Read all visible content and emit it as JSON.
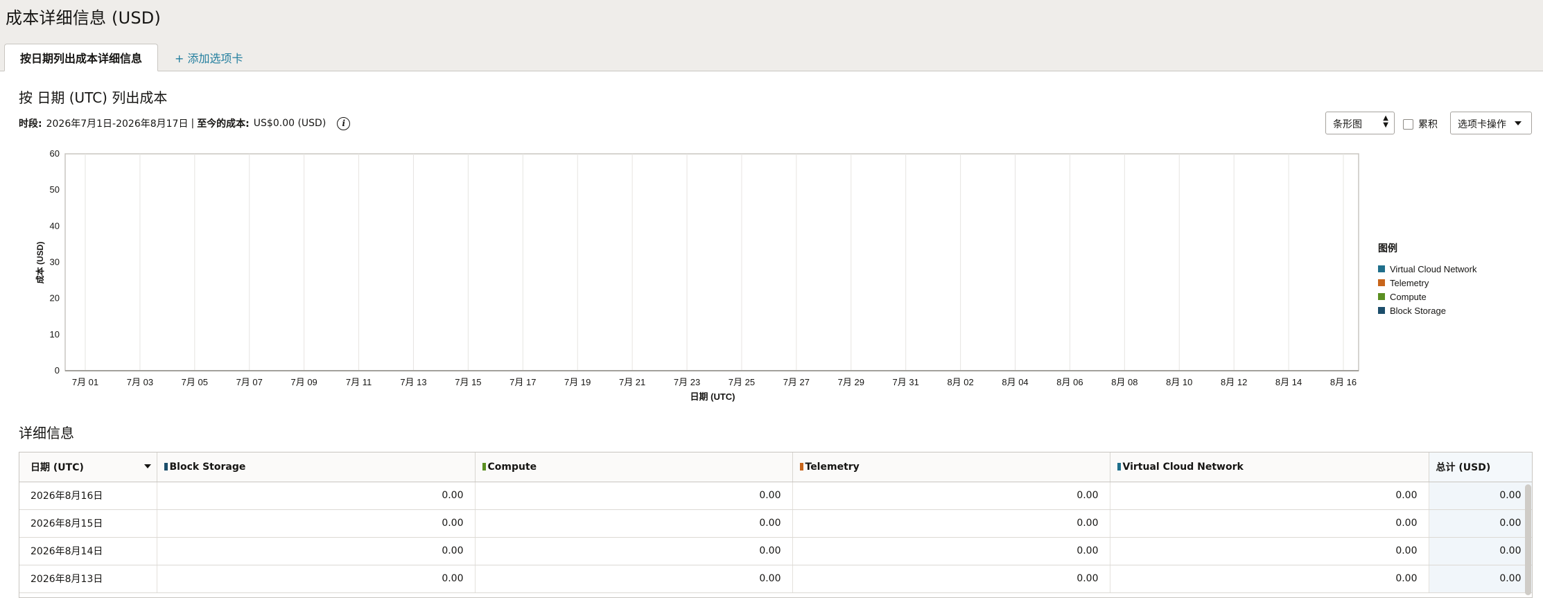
{
  "page_title": "成本详细信息 (USD)",
  "tabs": [
    {
      "label": "按日期列出成本详细信息"
    },
    {
      "label": "+ 添加选项卡"
    }
  ],
  "chart_section": {
    "title": "按 日期 (UTC) 列出成本",
    "period_label": "时段:",
    "period_value": "2026年7月1日-2026年8月17日",
    "separator": "|",
    "cost_label": "至今的成本:",
    "cost_value": "US$0.00 (USD)",
    "info_icon": "i"
  },
  "controls": {
    "chart_type": "条形图",
    "cumulative_label": "累积",
    "tab_actions_label": "选项卡操作"
  },
  "chart_data": {
    "type": "bar",
    "xlabel": "日期 (UTC)",
    "ylabel": "成本 (USD)",
    "ylim": [
      0,
      60
    ],
    "yticks": [
      0,
      10,
      20,
      30,
      40,
      50,
      60
    ],
    "categories": [
      "7月 01",
      "7月 03",
      "7月 05",
      "7月 07",
      "7月 09",
      "7月 11",
      "7月 13",
      "7月 15",
      "7月 17",
      "7月 19",
      "7月 21",
      "7月 23",
      "7月 25",
      "7月 27",
      "7月 29",
      "7月 31",
      "8月 02",
      "8月 04",
      "8月 06",
      "8月 08",
      "8月 10",
      "8月 12",
      "8月 14",
      "8月 16"
    ],
    "grid": true,
    "legend_title": "图例",
    "legend_position": "right",
    "series": [
      {
        "name": "Virtual Cloud Network",
        "color": "#1f6f8b",
        "values": []
      },
      {
        "name": "Telemetry",
        "color": "#c8651b",
        "values": []
      },
      {
        "name": "Compute",
        "color": "#5b8f22",
        "values": []
      },
      {
        "name": "Block Storage",
        "color": "#1c4e6b",
        "values": []
      }
    ]
  },
  "details": {
    "title": "详细信息",
    "columns": [
      {
        "label": "日期 (UTC)",
        "color": ""
      },
      {
        "label": "Block Storage",
        "color": "#1c4e6b"
      },
      {
        "label": "Compute",
        "color": "#5b8f22"
      },
      {
        "label": "Telemetry",
        "color": "#c8651b"
      },
      {
        "label": "Virtual Cloud Network",
        "color": "#1f6f8b"
      },
      {
        "label": "总计 (USD)",
        "color": ""
      }
    ],
    "rows": [
      [
        "2026年8月16日",
        "0.00",
        "0.00",
        "0.00",
        "0.00",
        "0.00"
      ],
      [
        "2026年8月15日",
        "0.00",
        "0.00",
        "0.00",
        "0.00",
        "0.00"
      ],
      [
        "2026年8月14日",
        "0.00",
        "0.00",
        "0.00",
        "0.00",
        "0.00"
      ],
      [
        "2026年8月13日",
        "0.00",
        "0.00",
        "0.00",
        "0.00",
        "0.00"
      ]
    ]
  }
}
